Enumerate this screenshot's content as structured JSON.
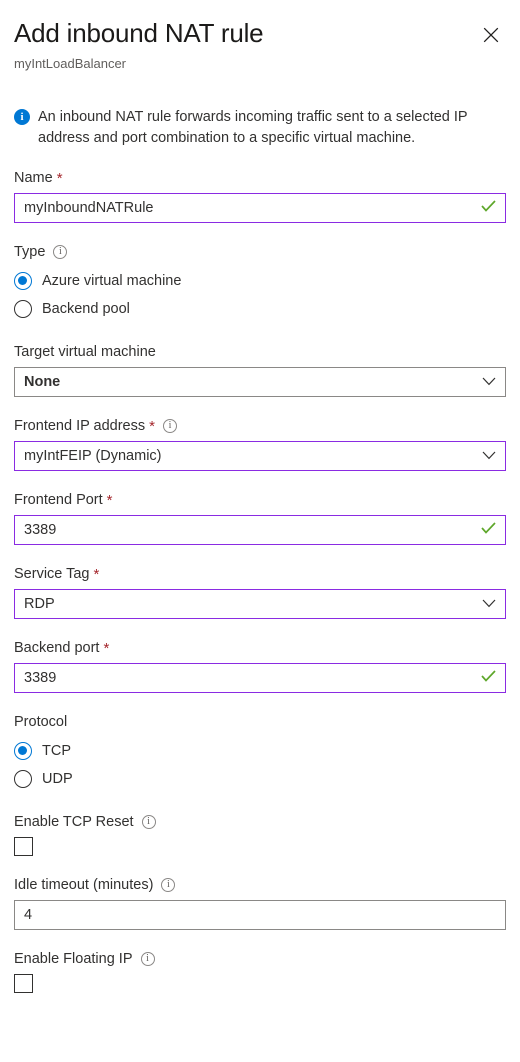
{
  "header": {
    "title": "Add inbound NAT rule",
    "subtitle": "myIntLoadBalancer",
    "close_label": "close-icon"
  },
  "banner": {
    "icon": "info-filled-icon",
    "text": "An inbound NAT rule forwards incoming traffic sent to a selected IP address and port combination to a specific virtual machine."
  },
  "form": {
    "name": {
      "label": "Name",
      "required": "*",
      "value": "myInboundNATRule",
      "validated": true
    },
    "type": {
      "label": "Type",
      "info": "i",
      "options": [
        {
          "label": "Azure virtual machine",
          "selected": true
        },
        {
          "label": "Backend pool",
          "selected": false
        }
      ]
    },
    "target_vm": {
      "label": "Target virtual machine",
      "value": "None"
    },
    "frontend_ip": {
      "label": "Frontend IP address",
      "required": "*",
      "info": "i",
      "value": "myIntFEIP (Dynamic)"
    },
    "frontend_port": {
      "label": "Frontend Port",
      "required": "*",
      "value": "3389",
      "validated": true
    },
    "service_tag": {
      "label": "Service Tag",
      "required": "*",
      "value": "RDP"
    },
    "backend_port": {
      "label": "Backend port",
      "required": "*",
      "value": "3389",
      "validated": true
    },
    "protocol": {
      "label": "Protocol",
      "options": [
        {
          "label": "TCP",
          "selected": true
        },
        {
          "label": "UDP",
          "selected": false
        }
      ]
    },
    "tcp_reset": {
      "label": "Enable TCP Reset",
      "info": "i",
      "checked": false
    },
    "idle_timeout": {
      "label": "Idle timeout (minutes)",
      "info": "i",
      "value": "4"
    },
    "floating_ip": {
      "label": "Enable Floating IP",
      "info": "i",
      "checked": false
    }
  },
  "colors": {
    "accent_blue": "#0078d4",
    "modified_purple": "#8a2be2",
    "valid_green": "#5ea72a",
    "required_red": "#a4262c"
  }
}
